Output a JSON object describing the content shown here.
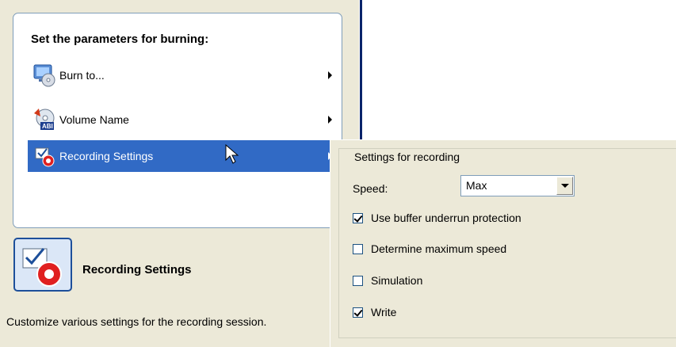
{
  "panel": {
    "title": "Set the parameters for burning:",
    "items": [
      {
        "label": "Burn to...",
        "icon": "burn-to-icon"
      },
      {
        "label": "Volume Name",
        "icon": "volume-name-icon"
      },
      {
        "label": "Recording Settings",
        "icon": "recording-settings-icon",
        "selected": true
      }
    ]
  },
  "detail": {
    "title": "Recording Settings",
    "description": "Customize various settings for the recording session."
  },
  "popup": {
    "legend": "Settings for recording",
    "speed_label": "Speed:",
    "speed_value": "Max",
    "options": [
      {
        "label": "Use buffer underrun protection",
        "checked": true
      },
      {
        "label": "Determine maximum speed",
        "checked": false
      },
      {
        "label": "Simulation",
        "checked": false
      },
      {
        "label": "Write",
        "checked": true
      }
    ]
  },
  "colors": {
    "selection": "#316ac5",
    "dialog_bg": "#ece9d8",
    "panel_border": "#7f9db9"
  }
}
